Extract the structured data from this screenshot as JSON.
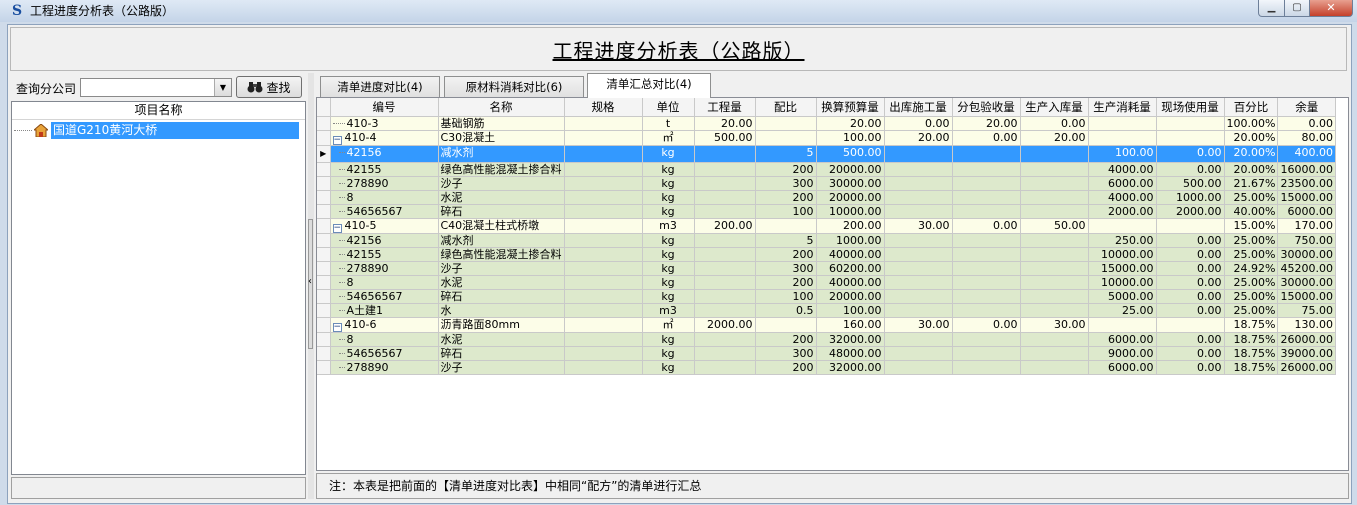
{
  "window": {
    "title": "工程进度分析表（公路版）"
  },
  "header": {
    "title": "工程进度分析表（公路版）"
  },
  "left": {
    "query_label": "查询分公司",
    "combo_value": "",
    "find_button": "查找",
    "tree_header": "项目名称",
    "tree_item": "国道G210黄河大桥"
  },
  "tabs": [
    {
      "label": "清单进度对比(4)"
    },
    {
      "label": "原材料消耗对比(6)"
    },
    {
      "label": "清单汇总对比(4)"
    }
  ],
  "columns": [
    "编号",
    "名称",
    "规格",
    "单位",
    "工程量",
    "配比",
    "换算预算量",
    "出库施工量",
    "分包验收量",
    "生产入库量",
    "生产消耗量",
    "现场使用量",
    "百分比",
    "余量"
  ],
  "rows": [
    {
      "type": "parent",
      "node": "",
      "cells": [
        "410-3",
        "基础钢筋",
        "",
        "t",
        "20.00",
        "",
        "20.00",
        "0.00",
        "20.00",
        "0.00",
        "",
        "",
        "100.00%",
        "0.00"
      ]
    },
    {
      "type": "parent",
      "node": "−",
      "cells": [
        "410-4",
        "C30混凝土",
        "",
        "㎡",
        "500.00",
        "",
        "100.00",
        "20.00",
        "0.00",
        "20.00",
        "",
        "",
        "20.00%",
        "80.00"
      ]
    },
    {
      "type": "sel",
      "node": "",
      "cells": [
        "42156",
        "减水剂",
        "",
        "kg",
        "",
        "5",
        "500.00",
        "",
        "",
        "",
        "100.00",
        "0.00",
        "20.00%",
        "400.00"
      ]
    },
    {
      "type": "child",
      "node": "",
      "cells": [
        "42155",
        "绿色高性能混凝土掺合料",
        "",
        "kg",
        "",
        "200",
        "20000.00",
        "",
        "",
        "",
        "4000.00",
        "0.00",
        "20.00%",
        "16000.00"
      ]
    },
    {
      "type": "child",
      "node": "",
      "cells": [
        "278890",
        "沙子",
        "",
        "kg",
        "",
        "300",
        "30000.00",
        "",
        "",
        "",
        "6000.00",
        "500.00",
        "21.67%",
        "23500.00"
      ]
    },
    {
      "type": "child",
      "node": "",
      "cells": [
        "8",
        "水泥",
        "",
        "kg",
        "",
        "200",
        "20000.00",
        "",
        "",
        "",
        "4000.00",
        "1000.00",
        "25.00%",
        "15000.00"
      ]
    },
    {
      "type": "child",
      "node": "",
      "cells": [
        "54656567",
        "碎石",
        "",
        "kg",
        "",
        "100",
        "10000.00",
        "",
        "",
        "",
        "2000.00",
        "2000.00",
        "40.00%",
        "6000.00"
      ]
    },
    {
      "type": "parent",
      "node": "−",
      "cells": [
        "410-5",
        "C40混凝土柱式桥墩",
        "",
        "m3",
        "200.00",
        "",
        "200.00",
        "30.00",
        "0.00",
        "50.00",
        "",
        "",
        "15.00%",
        "170.00"
      ]
    },
    {
      "type": "child",
      "node": "",
      "cells": [
        "42156",
        "减水剂",
        "",
        "kg",
        "",
        "5",
        "1000.00",
        "",
        "",
        "",
        "250.00",
        "0.00",
        "25.00%",
        "750.00"
      ]
    },
    {
      "type": "child",
      "node": "",
      "cells": [
        "42155",
        "绿色高性能混凝土掺合料",
        "",
        "kg",
        "",
        "200",
        "40000.00",
        "",
        "",
        "",
        "10000.00",
        "0.00",
        "25.00%",
        "30000.00"
      ]
    },
    {
      "type": "child",
      "node": "",
      "cells": [
        "278890",
        "沙子",
        "",
        "kg",
        "",
        "300",
        "60200.00",
        "",
        "",
        "",
        "15000.00",
        "0.00",
        "24.92%",
        "45200.00"
      ]
    },
    {
      "type": "child",
      "node": "",
      "cells": [
        "8",
        "水泥",
        "",
        "kg",
        "",
        "200",
        "40000.00",
        "",
        "",
        "",
        "10000.00",
        "0.00",
        "25.00%",
        "30000.00"
      ]
    },
    {
      "type": "child",
      "node": "",
      "cells": [
        "54656567",
        "碎石",
        "",
        "kg",
        "",
        "100",
        "20000.00",
        "",
        "",
        "",
        "5000.00",
        "0.00",
        "25.00%",
        "15000.00"
      ]
    },
    {
      "type": "child",
      "node": "",
      "cells": [
        "A土建1",
        "水",
        "",
        "m3",
        "",
        "0.5",
        "100.00",
        "",
        "",
        "",
        "25.00",
        "0.00",
        "25.00%",
        "75.00"
      ]
    },
    {
      "type": "parent",
      "node": "−",
      "cells": [
        "410-6",
        "沥青路面80mm",
        "",
        "㎡",
        "2000.00",
        "",
        "160.00",
        "30.00",
        "0.00",
        "30.00",
        "",
        "",
        "18.75%",
        "130.00"
      ]
    },
    {
      "type": "child",
      "node": "",
      "cells": [
        "8",
        "水泥",
        "",
        "kg",
        "",
        "200",
        "32000.00",
        "",
        "",
        "",
        "6000.00",
        "0.00",
        "18.75%",
        "26000.00"
      ]
    },
    {
      "type": "child",
      "node": "",
      "cells": [
        "54656567",
        "碎石",
        "",
        "kg",
        "",
        "300",
        "48000.00",
        "",
        "",
        "",
        "9000.00",
        "0.00",
        "18.75%",
        "39000.00"
      ]
    },
    {
      "type": "child",
      "node": "",
      "cells": [
        "278890",
        "沙子",
        "",
        "kg",
        "",
        "200",
        "32000.00",
        "",
        "",
        "",
        "6000.00",
        "0.00",
        "18.75%",
        "26000.00"
      ]
    }
  ],
  "note": "注：本表是把前面的【清单进度对比表】中相同“配方”的清单进行汇总",
  "colors": {
    "selection": "#3399ff",
    "parent_row": "#fcfde8",
    "child_row": "#dde9cc"
  }
}
